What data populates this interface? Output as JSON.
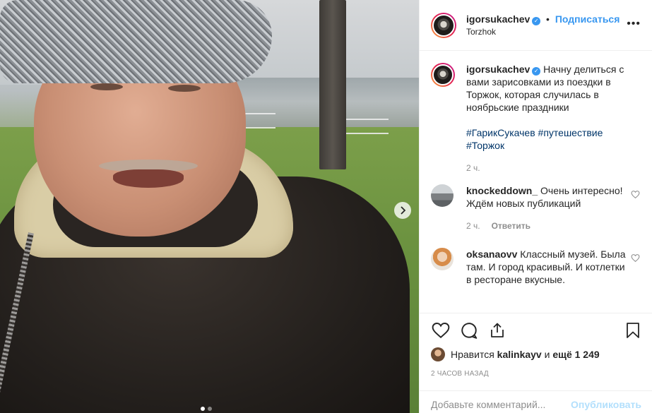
{
  "post": {
    "author": "igorsukachev",
    "follow_label": "Подписаться",
    "location": "Torzhok",
    "more_glyph": "•••",
    "verified_glyph": "✓"
  },
  "caption": {
    "author": "igorsukachev",
    "text": "Начну делиться с вами зарисовками из поездки в Торжок, которая случилась в ноябрьские праздники",
    "hashtags": [
      "#ГарикСукачев",
      "#путешествие",
      "#Торжок"
    ],
    "time": "2 ч."
  },
  "comments": [
    {
      "author": "knockeddown_",
      "text": "Очень интересно! Ждём новых публикаций",
      "time": "2 ч.",
      "reply_label": "Ответить"
    },
    {
      "author": "oksanaovv",
      "text": "Классный музей. Была там. И город красивый. И котлетки в ресторане вкусные."
    }
  ],
  "likes": {
    "prefix": "Нравится",
    "user": "kalinkayv",
    "connector": "и",
    "more": "ещё 1 249"
  },
  "timestamp": "2 ЧАСОВ НАЗАД",
  "add_comment": {
    "placeholder": "Добавьте комментарий...",
    "post_label": "Опубликовать"
  },
  "carousel": {
    "slide_count": 2,
    "active_index": 0
  },
  "colors": {
    "link": "#3897f0",
    "hashtag": "#003569",
    "muted": "#8e8e8e"
  }
}
